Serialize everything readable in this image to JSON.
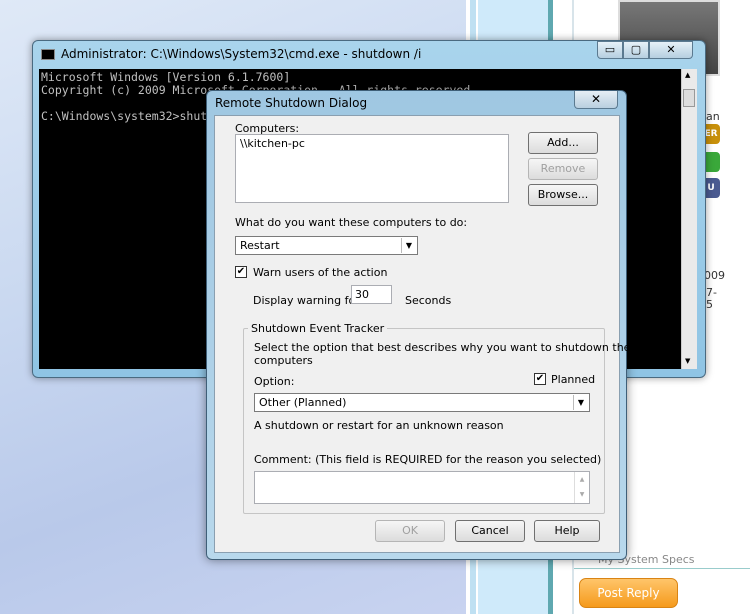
{
  "background_page": {
    "side_texts": [
      "an",
      "009",
      "7-",
      "5"
    ],
    "badges": [
      {
        "label": "ER",
        "color": "#c8900a"
      },
      {
        "label": "",
        "color": "#3aa83a"
      },
      {
        "label": "U",
        "color": "#4a5a90"
      }
    ],
    "specs_link": "My System Specs",
    "post_reply": "Post Reply"
  },
  "cmd": {
    "title": "Administrator: C:\\Windows\\System32\\cmd.exe - shutdown  /i",
    "lines": [
      "Microsoft Windows [Version 6.1.7600]",
      "Copyright (c) 2009 Microsoft Corporation.  All rights reserved.",
      "",
      "C:\\Windows\\system32>shutdown /i"
    ],
    "minimize": "▭",
    "maximize": "▢",
    "close": "✕"
  },
  "dialog": {
    "title": "Remote Shutdown Dialog",
    "close": "✕",
    "computers_label": "Computers:",
    "computers": [
      "\\\\kitchen-pc"
    ],
    "add": "Add...",
    "remove": "Remove",
    "browse": "Browse...",
    "action_label": "What do you want these computers to do:",
    "action_value": "Restart",
    "warn_label": "Warn users of the action",
    "warn_checked": true,
    "display_warning_label": "Display warning for",
    "warning_seconds": "30",
    "seconds_label": "Seconds",
    "tracker": {
      "title": "Shutdown Event Tracker",
      "desc1": "Select the option that best describes why you want to shutdown the",
      "desc2": "computers",
      "option_label": "Option:",
      "planned_label": "Planned",
      "planned_checked": true,
      "option_value": "Other (Planned)",
      "reason": "A shutdown or restart for an unknown reason",
      "comment_label": "Comment: (This field is REQUIRED for the reason you selected)",
      "comment_value": ""
    },
    "ok": "OK",
    "cancel": "Cancel",
    "help": "Help"
  }
}
